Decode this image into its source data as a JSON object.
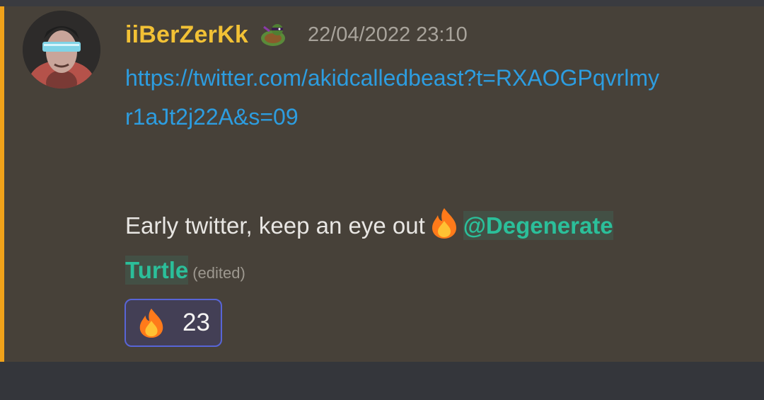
{
  "message": {
    "username": "iiBerZerKk",
    "timestamp": "22/04/2022 23:10",
    "link": "https://twitter.com/akidcalledbeast?t=RXAOGPqvrlmyr1aJt2j22A&s=09",
    "text_before_emoji": "Early twitter, keep an eye out",
    "mention_line1": "@Degenerate",
    "mention_line2": "Turtle",
    "edited_label": "(edited)",
    "role_icon": "turtle-ninja-icon",
    "avatar": "cyber-warrior-avatar",
    "emoji": "fire-emoji"
  },
  "reaction": {
    "emoji": "fire-emoji",
    "count": "23"
  },
  "colors": {
    "username": "#f2c135",
    "link": "#2d9de0",
    "mention": "#2bbf9a",
    "highlight_bar": "#f0a21a",
    "message_bg": "#474139",
    "reaction_border": "#5865d6"
  }
}
